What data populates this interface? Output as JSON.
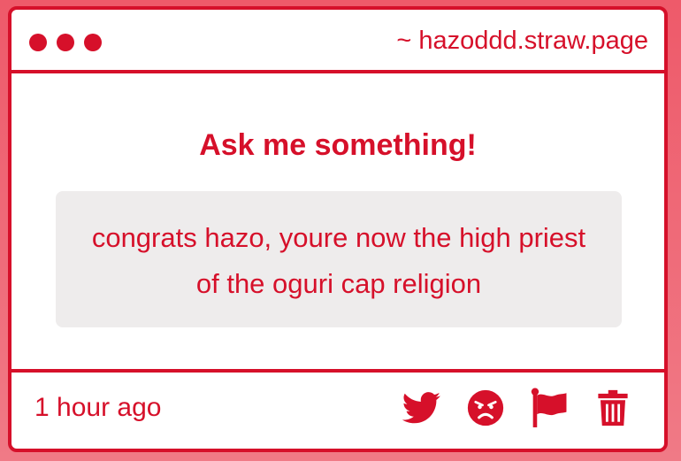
{
  "window": {
    "site_url": "~ hazoddd.straw.page"
  },
  "main": {
    "heading": "Ask me something!",
    "question": "congrats hazo, youre now the high priest of the oguri cap religion"
  },
  "footer": {
    "timestamp": "1 hour ago",
    "actions": [
      {
        "icon": "twitter-icon"
      },
      {
        "icon": "angry-face-icon"
      },
      {
        "icon": "flag-icon"
      },
      {
        "icon": "trash-icon"
      }
    ]
  },
  "colors": {
    "accent": "#d6102a",
    "background": "#ee5a6a",
    "card": "#ffffff",
    "question_box": "#eeecec"
  }
}
